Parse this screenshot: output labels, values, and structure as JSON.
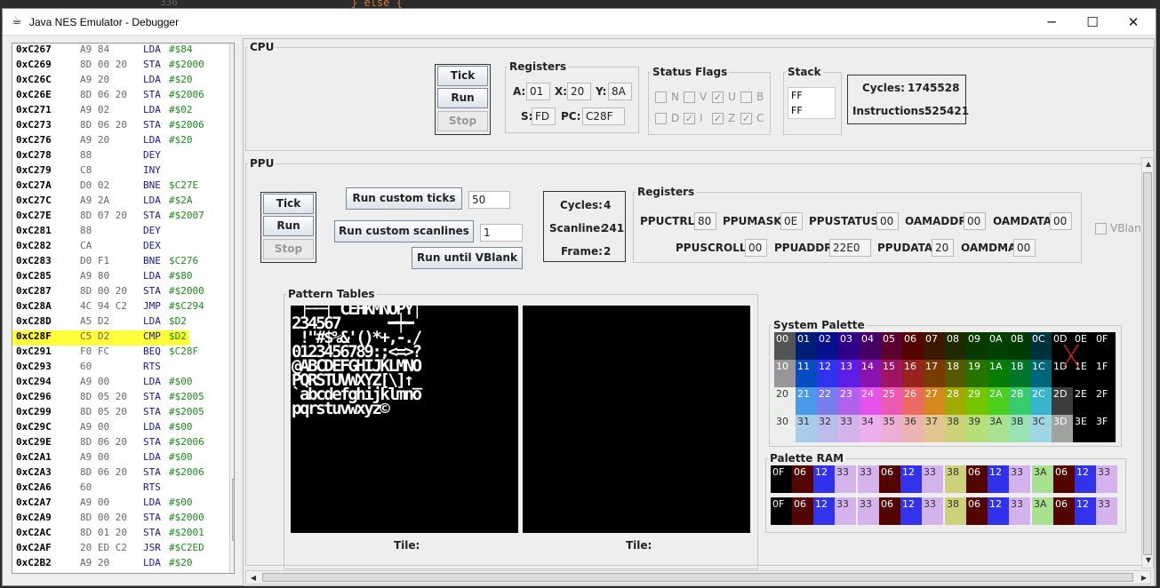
{
  "window": {
    "title": "Java NES Emulator - Debugger",
    "minimize": "─",
    "maximize": "☐",
    "close": "✕"
  },
  "ide": {
    "line": "336",
    "code": "} else {"
  },
  "disasm": [
    [
      "0xC267",
      "A9 84",
      "LDA",
      "#$84"
    ],
    [
      "0xC269",
      "8D 00 20",
      "STA",
      "#$2000"
    ],
    [
      "0xC26C",
      "A9 20",
      "LDA",
      "#$20"
    ],
    [
      "0xC26E",
      "8D 06 20",
      "STA",
      "#$2006"
    ],
    [
      "0xC271",
      "A9 02",
      "LDA",
      "#$02"
    ],
    [
      "0xC273",
      "8D 06 20",
      "STA",
      "#$2006"
    ],
    [
      "0xC276",
      "A9 20",
      "LDA",
      "#$20"
    ],
    [
      "0xC278",
      "88",
      "DEY",
      ""
    ],
    [
      "0xC279",
      "C8",
      "INY",
      ""
    ],
    [
      "0xC27A",
      "D0 02",
      "BNE",
      "$C27E"
    ],
    [
      "0xC27C",
      "A9 2A",
      "LDA",
      "#$2A"
    ],
    [
      "0xC27E",
      "8D 07 20",
      "STA",
      "#$2007"
    ],
    [
      "0xC281",
      "88",
      "DEY",
      ""
    ],
    [
      "0xC282",
      "CA",
      "DEX",
      ""
    ],
    [
      "0xC283",
      "D0 F1",
      "BNE",
      "$C276"
    ],
    [
      "0xC285",
      "A9 80",
      "LDA",
      "#$80"
    ],
    [
      "0xC287",
      "8D 00 20",
      "STA",
      "#$2000"
    ],
    [
      "0xC28A",
      "4C 94 C2",
      "JMP",
      "#$C294"
    ],
    [
      "0xC28D",
      "A5 D2",
      "LDA",
      "$D2"
    ],
    [
      "0xC28F",
      "C5 D2",
      "CMP",
      "$D2"
    ],
    [
      "0xC291",
      "F0 FC",
      "BEQ",
      "$C28F"
    ],
    [
      "0xC293",
      "60",
      "RTS",
      ""
    ],
    [
      "0xC294",
      "A9 00",
      "LDA",
      "#$00"
    ],
    [
      "0xC296",
      "8D 05 20",
      "STA",
      "#$2005"
    ],
    [
      "0xC299",
      "8D 05 20",
      "STA",
      "#$2005"
    ],
    [
      "0xC29C",
      "A9 00",
      "LDA",
      "#$00"
    ],
    [
      "0xC29E",
      "8D 06 20",
      "STA",
      "#$2006"
    ],
    [
      "0xC2A1",
      "A9 00",
      "LDA",
      "#$00"
    ],
    [
      "0xC2A3",
      "8D 06 20",
      "STA",
      "#$2006"
    ],
    [
      "0xC2A6",
      "60",
      "RTS",
      ""
    ],
    [
      "0xC2A7",
      "A9 00",
      "LDA",
      "#$00"
    ],
    [
      "0xC2A9",
      "8D 00 20",
      "STA",
      "#$2000"
    ],
    [
      "0xC2AC",
      "8D 01 20",
      "STA",
      "#$2001"
    ],
    [
      "0xC2AF",
      "20 ED C2",
      "JSR",
      "#$C2ED"
    ],
    [
      "0xC2B2",
      "A9 20",
      "LDA",
      "#$20"
    ]
  ],
  "highlight_row": 19,
  "cpu": {
    "title": "CPU",
    "buttons": {
      "tick": "Tick",
      "run": "Run",
      "stop": "Stop"
    },
    "registers": {
      "title": "Registers",
      "A_label": "A:",
      "A": "01",
      "X_label": "X:",
      "X": "20",
      "Y_label": "Y:",
      "Y": "8A",
      "S_label": "S:",
      "S": "FD",
      "PC_label": "PC:",
      "PC": "C28F"
    },
    "flags": {
      "title": "Status Flags",
      "items": [
        {
          "name": "N",
          "checked": false
        },
        {
          "name": "V",
          "checked": false
        },
        {
          "name": "U",
          "checked": true
        },
        {
          "name": "B",
          "checked": false
        },
        {
          "name": "D",
          "checked": false
        },
        {
          "name": "I",
          "checked": true
        },
        {
          "name": "Z",
          "checked": true
        },
        {
          "name": "C",
          "checked": true
        }
      ]
    },
    "stack": {
      "title": "Stack",
      "values": [
        "FF",
        "FF"
      ]
    },
    "cycles_label": "Cycles:",
    "cycles": "1745528",
    "instructions_label": "Instructions:",
    "instructions": "525421"
  },
  "ppu": {
    "title": "PPU",
    "buttons": {
      "tick": "Tick",
      "run": "Run",
      "stop": "Stop",
      "run_ticks": "Run custom ticks",
      "run_scanlines": "Run custom scanlines",
      "run_vblank": "Run until VBlank"
    },
    "ticks_value": "50",
    "scanlines_value": "1",
    "cycles_label": "Cycles:",
    "cycles": "4",
    "scanline_label": "Scanline:",
    "scanline": "241",
    "frame_label": "Frame:",
    "frame": "2",
    "registers": {
      "title": "Registers",
      "ppuctrl_label": "PPUCTRL:",
      "ppuctrl": "80",
      "ppumask_label": "PPUMASK:",
      "ppumask": "0E",
      "ppustatus_label": "PPUSTATUS:",
      "ppustatus": "00",
      "oamaddr_label": "OAMADDR:",
      "oamaddr": "00",
      "oamdata_label": "OAMDATA:",
      "oamdata": "00",
      "ppuscroll_label": "PPUSCROLL:",
      "ppuscroll": "00",
      "ppuaddr_label": "PPUADDR:",
      "ppuaddr": "22E0",
      "ppudata_label": "PPUDATA:",
      "ppudata": "20",
      "oamdma_label": "OAMDMA:",
      "oamdma": "00"
    },
    "vblank_label": "VBlank",
    "pattern": {
      "title": "Pattern Tables",
      "tile_left": "Tile:",
      "tile_right": "Tile:",
      "lines": [
        " ├──┤ CEHKMNOPY│",
        "234567      ━┿━",
        " !\"#$%&'()*+,-./",
        "0123456789:;<=>?",
        "@ABCDEFGHIJKLMNO",
        "PQRSTUVWXYZ[\\]↑_",
        "`abcdefghijklmno",
        "pqrstuvwxyz©"
      ]
    },
    "system_palette": {
      "title": "System Palette",
      "labels": [
        "00",
        "01",
        "02",
        "03",
        "04",
        "05",
        "06",
        "07",
        "08",
        "09",
        "0A",
        "0B",
        "0C",
        "0D",
        "0E",
        "0F",
        "10",
        "11",
        "12",
        "13",
        "14",
        "15",
        "16",
        "17",
        "18",
        "19",
        "1A",
        "1B",
        "1C",
        "1D",
        "1E",
        "1F",
        "20",
        "21",
        "22",
        "23",
        "24",
        "25",
        "26",
        "27",
        "28",
        "29",
        "2A",
        "2B",
        "2C",
        "2D",
        "2E",
        "2F",
        "30",
        "31",
        "32",
        "33",
        "34",
        "35",
        "36",
        "37",
        "38",
        "39",
        "3A",
        "3B",
        "3C",
        "3D",
        "3E",
        "3F"
      ],
      "colors": [
        "#545454",
        "#001e74",
        "#081090",
        "#300088",
        "#440064",
        "#5c0030",
        "#540400",
        "#3c1800",
        "#202a00",
        "#083a00",
        "#004000",
        "#003c00",
        "#00323c",
        "#000000",
        "#000000",
        "#000000",
        "#989698",
        "#084cc4",
        "#3032ec",
        "#5c1ee4",
        "#8814b0",
        "#a01464",
        "#982220",
        "#783c00",
        "#545a00",
        "#287200",
        "#087c00",
        "#007628",
        "#006678",
        "#000000",
        "#000000",
        "#000000",
        "#eceeec",
        "#4c9aec",
        "#787cec",
        "#b062ec",
        "#e454ec",
        "#ec58b4",
        "#ec6a64",
        "#d48820",
        "#a0aa00",
        "#74c400",
        "#4cd020",
        "#38cc6c",
        "#38b4cc",
        "#3c3c3c",
        "#000000",
        "#000000",
        "#eceeec",
        "#a8ccec",
        "#bcbcec",
        "#d4b2ec",
        "#ecaeec",
        "#ecaed4",
        "#ecb4b0",
        "#e4c490",
        "#ccd278",
        "#b4de78",
        "#a8e290",
        "#98e2b4",
        "#a0d6e4",
        "#a0a2a0",
        "#000000",
        "#000000"
      ]
    },
    "palette_ram": {
      "title": "Palette RAM",
      "rows": [
        [
          [
            "0F",
            "#000000"
          ],
          [
            "06",
            "#540400"
          ],
          [
            "12",
            "#3032ec"
          ],
          [
            "33",
            "#d4b2ec"
          ],
          [
            "33",
            "#d4b2ec"
          ],
          [
            "06",
            "#540400"
          ],
          [
            "12",
            "#3032ec"
          ],
          [
            "33",
            "#d4b2ec"
          ],
          [
            "38",
            "#ccd278"
          ],
          [
            "06",
            "#540400"
          ],
          [
            "12",
            "#3032ec"
          ],
          [
            "33",
            "#d4b2ec"
          ],
          [
            "3A",
            "#a8e290"
          ],
          [
            "06",
            "#540400"
          ],
          [
            "12",
            "#3032ec"
          ],
          [
            "33",
            "#d4b2ec"
          ]
        ],
        [
          [
            "0F",
            "#000000"
          ],
          [
            "06",
            "#540400"
          ],
          [
            "12",
            "#3032ec"
          ],
          [
            "33",
            "#d4b2ec"
          ],
          [
            "33",
            "#d4b2ec"
          ],
          [
            "06",
            "#540400"
          ],
          [
            "12",
            "#3032ec"
          ],
          [
            "33",
            "#d4b2ec"
          ],
          [
            "38",
            "#ccd278"
          ],
          [
            "06",
            "#540400"
          ],
          [
            "12",
            "#3032ec"
          ],
          [
            "33",
            "#d4b2ec"
          ],
          [
            "3A",
            "#a8e290"
          ],
          [
            "06",
            "#540400"
          ],
          [
            "12",
            "#3032ec"
          ],
          [
            "33",
            "#d4b2ec"
          ]
        ]
      ]
    }
  }
}
